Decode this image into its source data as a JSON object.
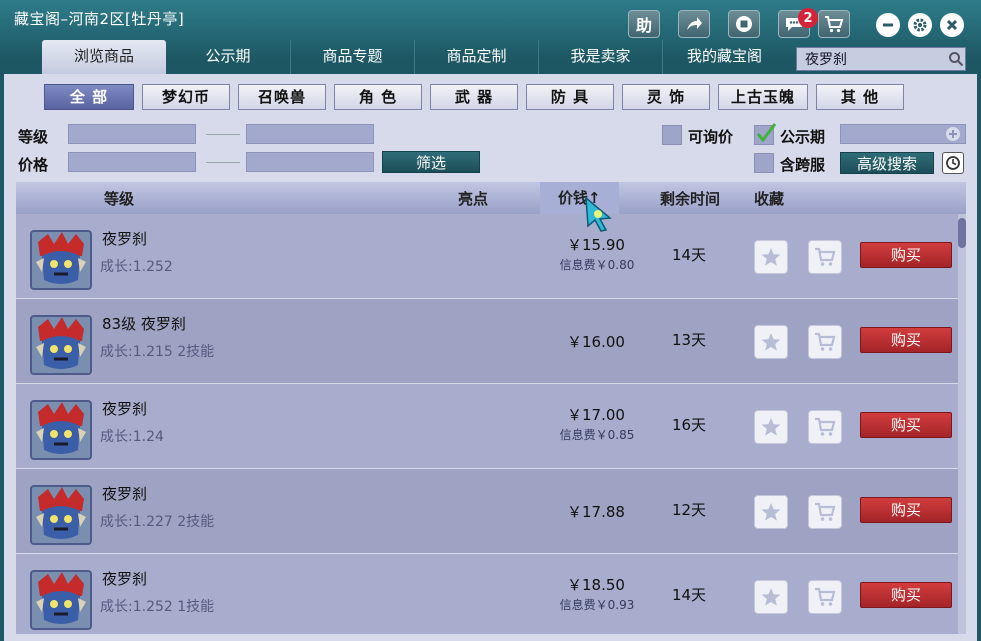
{
  "window": {
    "title": "藏宝阁–河南2区[牡丹亭]",
    "help_label": "助",
    "message_count": "2"
  },
  "nav": {
    "tabs": [
      "浏览商品",
      "公示期",
      "商品专题",
      "商品定制",
      "我是卖家",
      "我的藏宝阁"
    ],
    "search_value": "夜罗刹"
  },
  "categories": [
    "全 部",
    "梦幻币",
    "召唤兽",
    "角 色",
    "武 器",
    "防 具",
    "灵 饰",
    "上古玉魄",
    "其 他"
  ],
  "filters": {
    "level_label": "等级",
    "price_label": "价格",
    "filter_button": "筛选",
    "inquiry_label": "可询价",
    "publicity_label": "公示期",
    "crossserver_label": "含跨服",
    "advanced_search": "高级搜索"
  },
  "table": {
    "headers": {
      "level": "等级",
      "highlight": "亮点",
      "price": "价钱↑",
      "remaining": "剩余时间",
      "favorite": "收藏"
    },
    "buy_label": "购买",
    "rows": [
      {
        "name": "夜罗刹",
        "growth": "成长:1.252",
        "price": "￥15.90",
        "fee": "信息费￥0.80",
        "remaining": "14天"
      },
      {
        "name": "83级  夜罗刹",
        "growth": "成长:1.215  2技能",
        "price": "￥16.00",
        "fee": "",
        "remaining": "13天"
      },
      {
        "name": "夜罗刹",
        "growth": "成长:1.24",
        "price": "￥17.00",
        "fee": "信息费￥0.85",
        "remaining": "16天"
      },
      {
        "name": "夜罗刹",
        "growth": "成长:1.227  2技能",
        "price": "￥17.88",
        "fee": "",
        "remaining": "12天"
      },
      {
        "name": "夜罗刹",
        "growth": "成长:1.252  1技能",
        "price": "￥18.50",
        "fee": "信息费￥0.93",
        "remaining": "14天"
      }
    ]
  }
}
